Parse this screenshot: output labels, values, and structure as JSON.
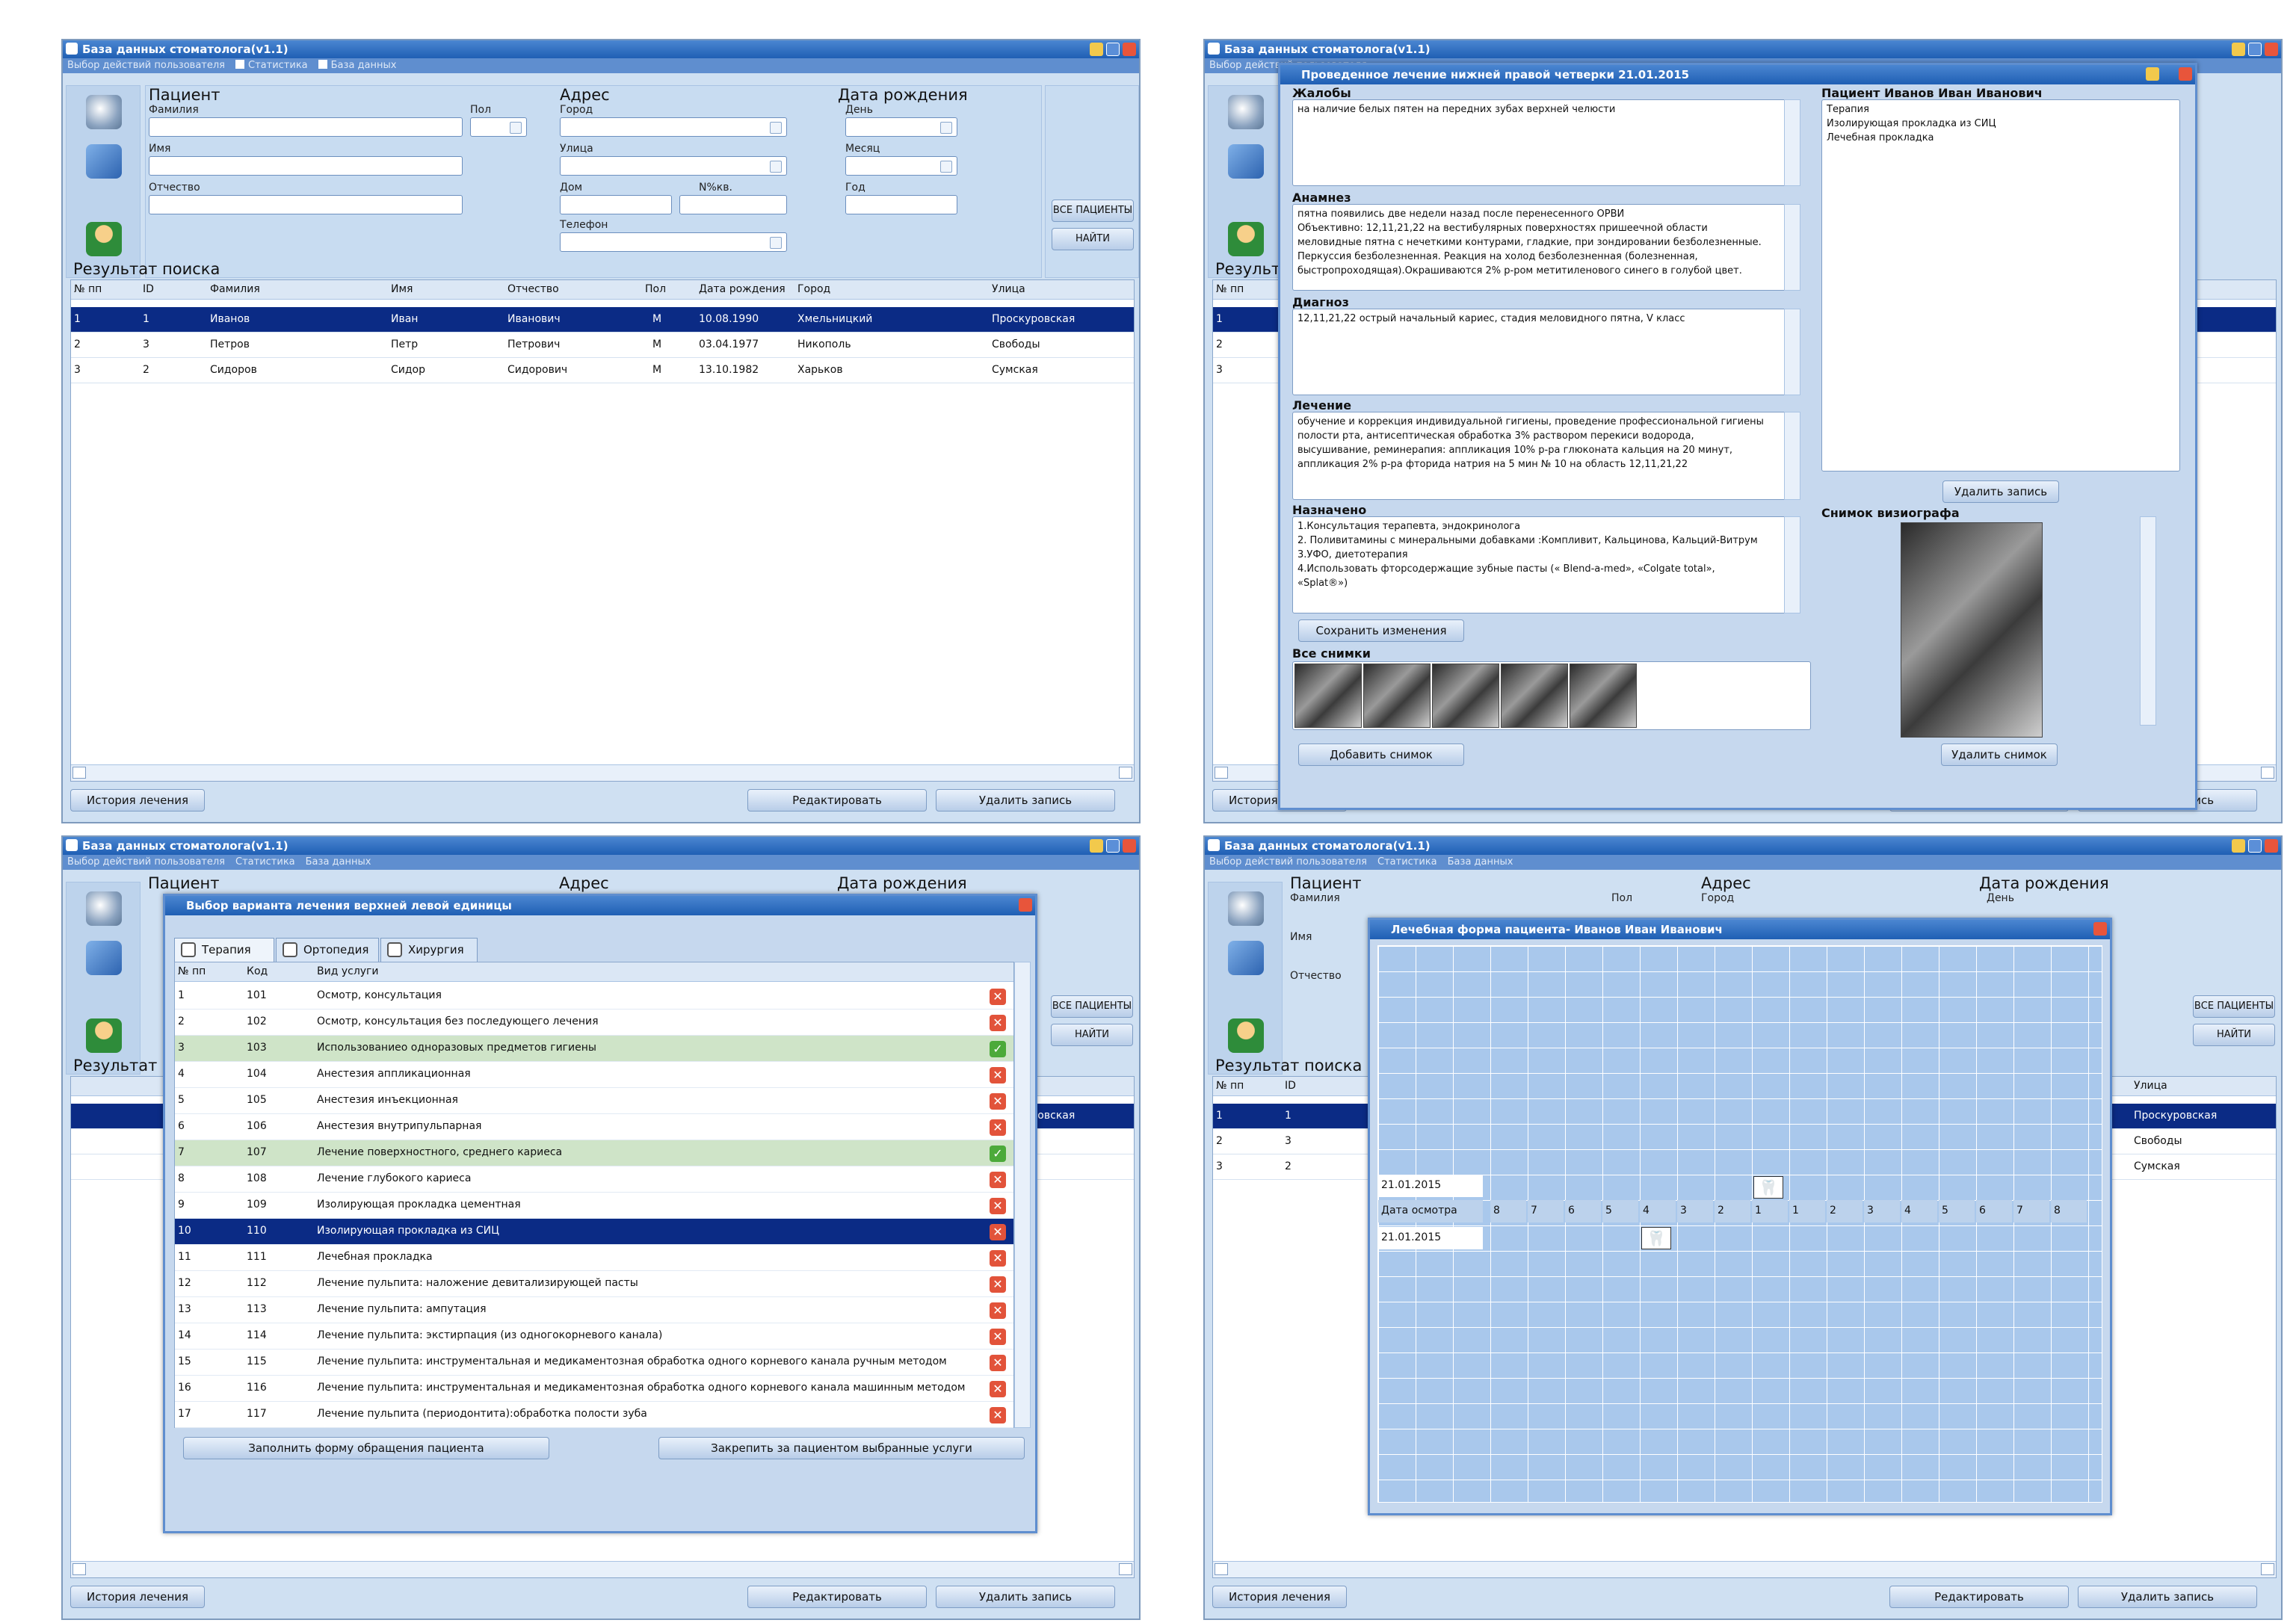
{
  "app": {
    "title": "База данных стоматолога(v1.1)",
    "menu": [
      "Выбор действий пользователя",
      "Статистика",
      "База данных"
    ]
  },
  "search": {
    "patient_h": "Пациент",
    "address_h": "Адрес",
    "birth_h": "Дата рождения",
    "surname": "Фамилия",
    "name": "Имя",
    "patronymic": "Отчество",
    "sex": "Пол",
    "city": "Город",
    "street": "Улица",
    "house": "Дом",
    "flat": "N%кв.",
    "phone": "Телефон",
    "day": "День",
    "month": "Месяц",
    "year": "Год",
    "all_patients": "ВСЕ ПАЦИЕНТЫ",
    "find": "НАЙТИ"
  },
  "results": {
    "title": "Результат поиска",
    "headers": [
      "№ пп",
      "ID",
      "Фамилия",
      "Имя",
      "Отчество",
      "Пол",
      "Дата рождения",
      "Город",
      "Улица"
    ],
    "rows": [
      [
        "1",
        "1",
        "Иванов",
        "Иван",
        "Иванович",
        "М",
        "10.08.1990",
        "Хмельницкий",
        "Проскуровская"
      ],
      [
        "2",
        "3",
        "Петров",
        "Петр",
        "Петрович",
        "М",
        "03.04.1977",
        "Никополь",
        "Свободы"
      ],
      [
        "3",
        "2",
        "Сидоров",
        "Сидор",
        "Сидорович",
        "М",
        "13.10.1982",
        "Харьков",
        "Сумская"
      ]
    ]
  },
  "bottom": {
    "history": "История лечения",
    "edit": "Редактировать",
    "delete": "Удалить запись"
  },
  "treatment": {
    "title": "Проведенное лечение нижней правой четверки 21.01.2015",
    "complaints_h": "Жалобы",
    "complaints": "на наличие белых пятен на передних зубах верхней челюсти",
    "anamnesis_h": "Анамнез",
    "anamnesis": "пятна появились две недели назад после перенесенного ОРВИ\nОбъективно: 12,11,21,22 на вестибулярных поверхностях  пришеечной области\nмеловидные пятна с нечеткими контурами, гладкие, при зондировании безболезненные.\nПеркуссия безболезненная. Реакция на холод безболезненная (болезненная,\nбыстропроходящая).Окрашиваются 2% р-ром метитиленового синего в  голубой цвет.",
    "diagnosis_h": "Диагноз",
    "diagnosis": "12,11,21,22 острый начальный кариес, стадия меловидного пятна, V класс",
    "treatment_h": "Лечение",
    "treatment_text": "обучение и коррекция индивидуальной гигиены, проведение профессиональной гигиены\nполости рта, антисептическая  обработка 3% раствором перекиси водорода,\nвысушивание, реминерапия: аппликация 10% р-ра глюконата кальция на 20 минут,\nаппликация  2% р-ра фторида натрия на 5 мин № 10 на область 12,11,21,22",
    "prescribed_h": "Назначено",
    "prescribed": "1.Консультация терапевта, эндокринолога\n2. Поливитамины с минеральными добавками :Компливит, Кальцинова, Кальций-Витрум\n3.УФО, диетотерапия\n4.Использовать фторсодержащие зубные пасты (« Blend-a-med», «Colgate total»,\n«Splat®»)",
    "save": "Сохранить изменения",
    "all_images_h": "Все снимки",
    "add_image": "Добавить снимок",
    "patient_h": "Пациент Иванов Иван Иванович",
    "patient_items": "Терапия\nИзолирующая прокладка из СИЦ\nЛечебная прокладка",
    "delete_record": "Удалить запись",
    "visio_h": "Снимок визиографа",
    "delete_image": "Удалить снимок"
  },
  "services": {
    "title": "Выбор варианта лечения верхней левой единицы",
    "tabs": [
      "Терапия",
      "Ортопедия",
      "Хирургия"
    ],
    "headers": [
      "№ пп",
      "Код",
      "Вид услуги"
    ],
    "rows": [
      [
        "1",
        "101",
        "Осмотр, консультация"
      ],
      [
        "2",
        "102",
        "Осмотр, консультация без последующего лечения"
      ],
      [
        "3",
        "103",
        "Использованиео одноразовых предметов гигиены"
      ],
      [
        "4",
        "104",
        "Анестезия аппликационная"
      ],
      [
        "5",
        "105",
        "Анестезия инъекционная"
      ],
      [
        "6",
        "106",
        "Анестезия внутрипульпарная"
      ],
      [
        "7",
        "107",
        "Лечение поверхностного, среднего кариеса"
      ],
      [
        "8",
        "108",
        "Лечение глубокого кариеса"
      ],
      [
        "9",
        "109",
        "Изолирующая прокладка цементная"
      ],
      [
        "10",
        "110",
        "Изолирующая прокладка из СИЦ"
      ],
      [
        "11",
        "111",
        "Лечебная прокладка"
      ],
      [
        "12",
        "112",
        "Лечение пульпита: наложение девитализирующей пасты"
      ],
      [
        "13",
        "113",
        "Лечение пульпита: ампутация"
      ],
      [
        "14",
        "114",
        "Лечение пульпита: экстирпация (из одногокорневого канала)"
      ],
      [
        "15",
        "115",
        "Лечение пульпита: инструментальная и медикаментозная обработка одного корневого канала ручным методом"
      ],
      [
        "16",
        "116",
        "Лечение пульпита: инструментальная и медикаментозная обработка одного корневого канала машинным методом"
      ],
      [
        "17",
        "117",
        "Лечение пульпита (периодонтита):обработка полости зуба"
      ]
    ],
    "fill": "Заполнить форму обращения пациента",
    "assign": "Закрепить за пациентом выбранные услуги"
  },
  "chart": {
    "title": "Лечебная форма пациента- Иванов Иван Иванович",
    "date_label": "Дата осмотра",
    "date1": "21.01.2015",
    "date2": "21.01.2015",
    "teeth": [
      "8",
      "7",
      "6",
      "5",
      "4",
      "3",
      "2",
      "1",
      "1",
      "2",
      "3",
      "4",
      "5",
      "6",
      "7",
      "8"
    ],
    "tooth_icon": "tooth-icon"
  }
}
